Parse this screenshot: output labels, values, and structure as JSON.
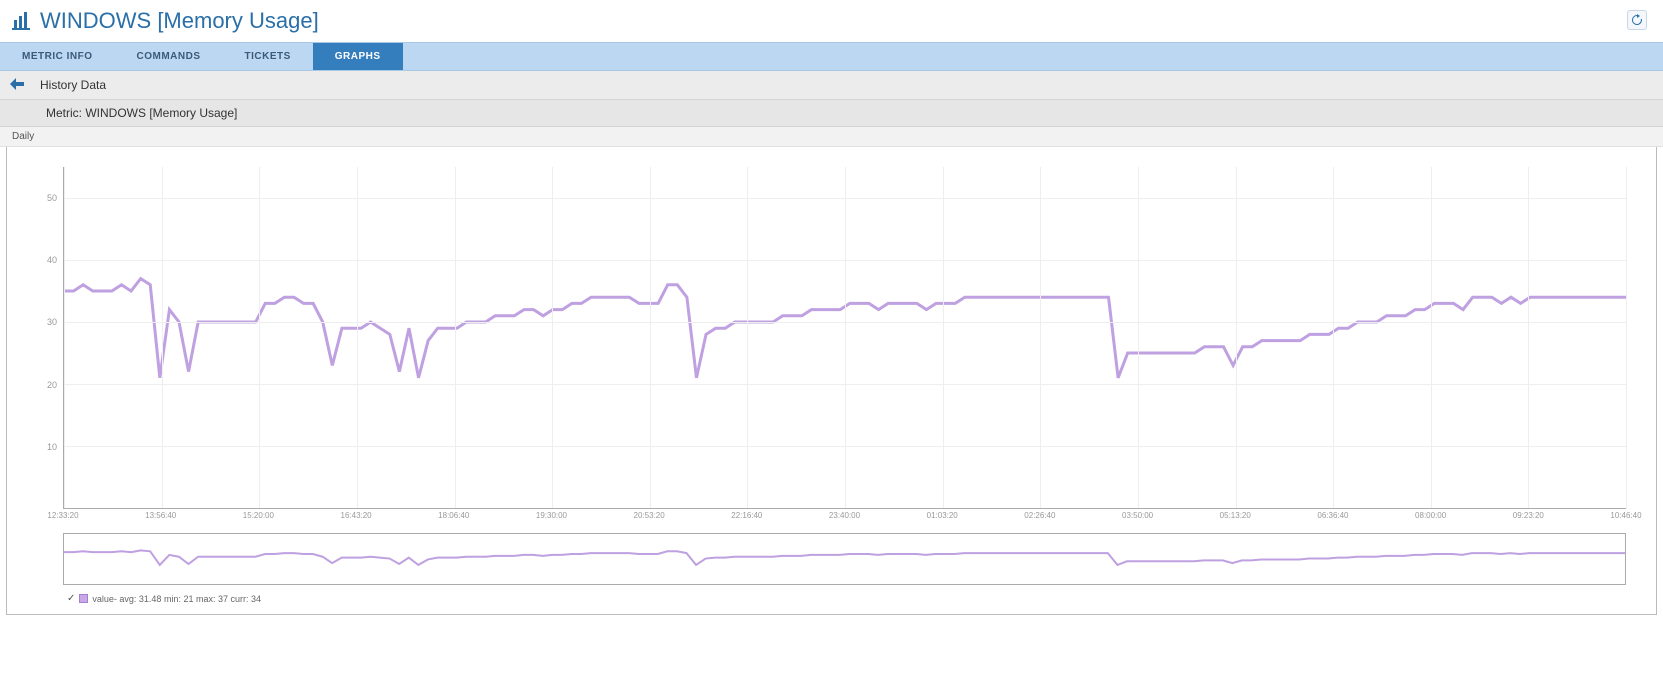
{
  "header": {
    "title": "WINDOWS [Memory Usage]"
  },
  "tabs": [
    {
      "label": "METRIC INFO",
      "active": false
    },
    {
      "label": "COMMANDS",
      "active": false
    },
    {
      "label": "TICKETS",
      "active": false
    },
    {
      "label": "GRAPHS",
      "active": true
    }
  ],
  "history_bar": {
    "label": "History Data"
  },
  "metric_bar": {
    "label": "Metric: WINDOWS [Memory Usage]"
  },
  "period_bar": {
    "label": "Daily"
  },
  "chart_data": {
    "type": "line",
    "title": "",
    "xlabel": "",
    "ylabel": "",
    "ylim": [
      0,
      55
    ],
    "y_ticks": [
      10,
      20,
      30,
      40,
      50
    ],
    "x_categories": [
      "12:33:20",
      "13:56:40",
      "15:20:00",
      "16:43:20",
      "18:06:40",
      "19:30:00",
      "20:53:20",
      "22:16:40",
      "23:40:00",
      "01:03:20",
      "02:26:40",
      "03:50:00",
      "05:13:20",
      "06:36:40",
      "08:00:00",
      "09:23:20",
      "10:46:40"
    ],
    "series": [
      {
        "name": "value",
        "color": "#bfa0e0",
        "stats": {
          "avg": 31.48,
          "min": 21,
          "max": 37,
          "curr": 34
        },
        "values": [
          35,
          35,
          36,
          35,
          35,
          35,
          36,
          35,
          37,
          36,
          21,
          32,
          30,
          22,
          30,
          30,
          30,
          30,
          30,
          30,
          30,
          33,
          33,
          34,
          34,
          33,
          33,
          30,
          23,
          29,
          29,
          29,
          30,
          29,
          28,
          22,
          29,
          21,
          27,
          29,
          29,
          29,
          30,
          30,
          30,
          31,
          31,
          31,
          32,
          32,
          31,
          32,
          32,
          33,
          33,
          34,
          34,
          34,
          34,
          34,
          33,
          33,
          33,
          36,
          36,
          34,
          21,
          28,
          29,
          29,
          30,
          30,
          30,
          30,
          30,
          31,
          31,
          31,
          32,
          32,
          32,
          32,
          33,
          33,
          33,
          32,
          33,
          33,
          33,
          33,
          32,
          33,
          33,
          33,
          34,
          34,
          34,
          34,
          34,
          34,
          34,
          34,
          34,
          34,
          34,
          34,
          34,
          34,
          34,
          34,
          21,
          25,
          25,
          25,
          25,
          25,
          25,
          25,
          25,
          26,
          26,
          26,
          23,
          26,
          26,
          27,
          27,
          27,
          27,
          27,
          28,
          28,
          28,
          29,
          29,
          30,
          30,
          30,
          31,
          31,
          31,
          32,
          32,
          33,
          33,
          33,
          32,
          34,
          34,
          34,
          33,
          34,
          33,
          34,
          34,
          34,
          34,
          34,
          34,
          34,
          34,
          34,
          34,
          34
        ]
      }
    ]
  },
  "legend_text": "value- avg: 31.48 min: 21 max: 37 curr: 34"
}
